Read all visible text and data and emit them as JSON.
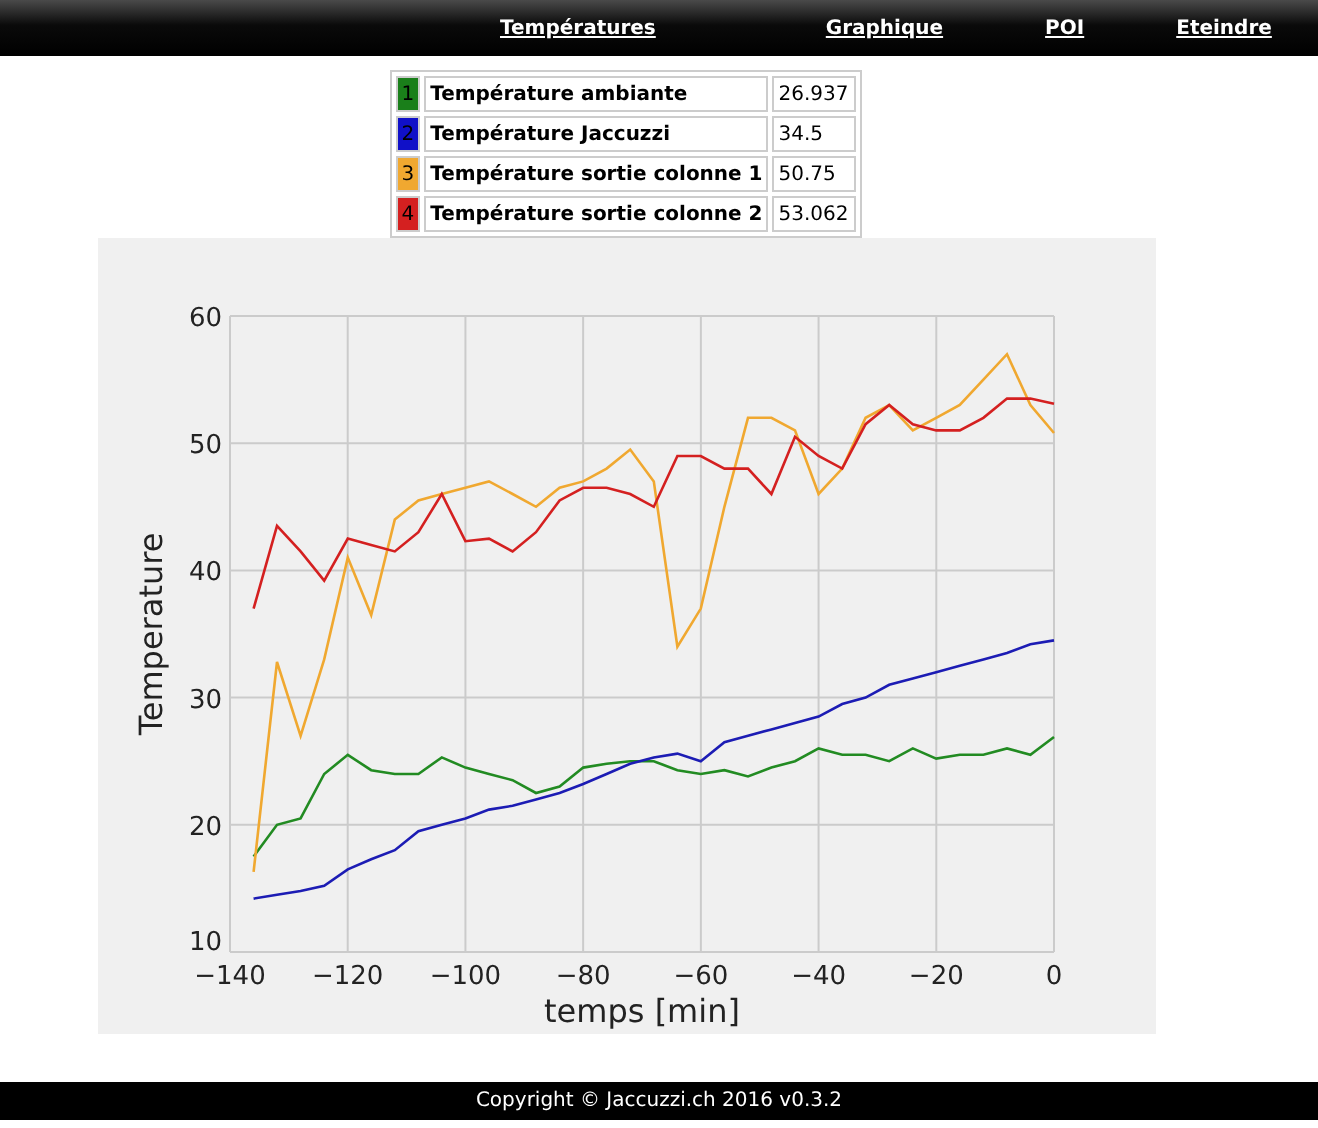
{
  "nav": {
    "links": [
      {
        "label": "Températures"
      },
      {
        "label": "Graphique"
      },
      {
        "label": "POI"
      },
      {
        "label": "Eteindre"
      }
    ]
  },
  "legend": [
    {
      "number": "1",
      "color": "#1a7f1a",
      "name": "Température ambiante",
      "value": "26.937"
    },
    {
      "number": "2",
      "color": "#1010c8",
      "name": "Température Jaccuzzi",
      "value": "34.5"
    },
    {
      "number": "3",
      "color": "#f0a830",
      "name": "Température sortie colonne 1",
      "value": "50.75"
    },
    {
      "number": "4",
      "color": "#d42020",
      "name": "Température sortie colonne 2",
      "value": "53.062"
    }
  ],
  "chart": {
    "chart_data": {
      "type": "line",
      "xlabel": "temps [min]",
      "ylabel": "Temperature",
      "x": [
        -136,
        -132,
        -128,
        -124,
        -120,
        -116,
        -112,
        -108,
        -104,
        -100,
        -96,
        -92,
        -88,
        -84,
        -80,
        -76,
        -72,
        -68,
        -64,
        -60,
        -56,
        -52,
        -48,
        -44,
        -40,
        -36,
        -32,
        -28,
        -24,
        -20,
        -16,
        -12,
        -8,
        -4,
        0
      ],
      "grid": true,
      "series": [
        {
          "color": "#228b22",
          "values": [
            17.5,
            20,
            20.5,
            24,
            25.5,
            24.3,
            24,
            24,
            25.3,
            24.5,
            24,
            23.5,
            22.5,
            23,
            24.5,
            24.8,
            25,
            25,
            24.3,
            24,
            24.3,
            23.8,
            24.5,
            25,
            26,
            25.5,
            25.5,
            25,
            26,
            25.2,
            25.5,
            25.5,
            26,
            25.5,
            26.9
          ]
        },
        {
          "color": "#1c1cb4",
          "values": [
            14.2,
            14.5,
            14.8,
            15.2,
            16.5,
            17.3,
            18,
            19.5,
            20,
            20.5,
            21.2,
            21.5,
            22,
            22.5,
            23.2,
            24,
            24.8,
            25.3,
            25.6,
            25,
            26.5,
            27,
            27.5,
            28,
            28.5,
            29.5,
            30,
            31,
            31.5,
            32,
            32.5,
            33,
            33.5,
            34.2,
            34.5
          ]
        },
        {
          "color": "#f0a830",
          "values": [
            16.3,
            32.8,
            27,
            33,
            41,
            36.5,
            44,
            45.5,
            46,
            46.5,
            47,
            46,
            45,
            46.5,
            47,
            48,
            49.5,
            47,
            34,
            37,
            45,
            52,
            52,
            51,
            46,
            48,
            52,
            53,
            51,
            52,
            53,
            55,
            57,
            53,
            50.8
          ]
        },
        {
          "color": "#d42020",
          "values": [
            37,
            43.5,
            41.5,
            39.2,
            42.5,
            42,
            41.5,
            43,
            46,
            42.3,
            42.5,
            41.5,
            43,
            45.5,
            46.5,
            46.5,
            46,
            45,
            49,
            49,
            48,
            48,
            46,
            50.5,
            49,
            48,
            51.5,
            53,
            51.5,
            51,
            51,
            52,
            53.5,
            53.5,
            53.1
          ]
        }
      ],
      "xlim": [
        -140,
        0
      ],
      "ylim": [
        10,
        60
      ],
      "xticks": [
        {
          "value": -140,
          "label": "−140"
        },
        {
          "value": -120,
          "label": "−120"
        },
        {
          "value": -100,
          "label": "−100"
        },
        {
          "value": -80,
          "label": "−80"
        },
        {
          "value": -60,
          "label": "−60"
        },
        {
          "value": -40,
          "label": "−40"
        },
        {
          "value": -20,
          "label": "−20"
        },
        {
          "value": 0,
          "label": "0"
        }
      ],
      "yticks": [
        10,
        20,
        30,
        40,
        50,
        60
      ]
    }
  },
  "footer": {
    "text": "Copyright © Jaccuzzi.ch 2016 v0.3.2"
  }
}
